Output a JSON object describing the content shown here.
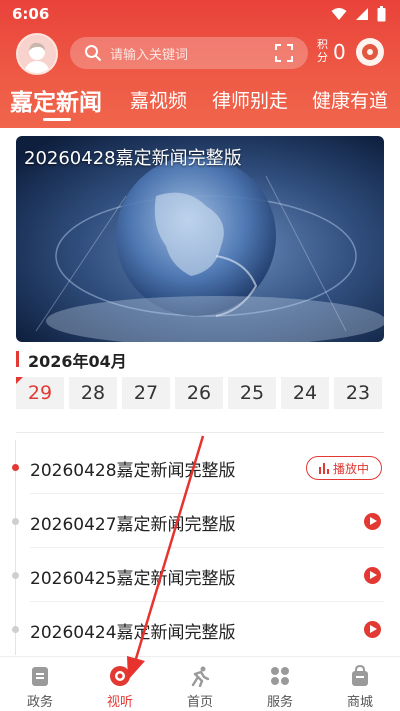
{
  "status_bar": {
    "time": "6:06"
  },
  "header": {
    "search": {
      "placeholder": "请输入关键词"
    },
    "points": {
      "label": "积分",
      "value": "0"
    }
  },
  "tabs": [
    {
      "label": "嘉定新闻",
      "active": true
    },
    {
      "label": "嘉视频"
    },
    {
      "label": "律师别走"
    },
    {
      "label": "健康有道"
    }
  ],
  "video": {
    "title": "20260428嘉定新闻完整版"
  },
  "calendar": {
    "month": "2026年04月",
    "dates": [
      "29",
      "28",
      "27",
      "26",
      "25",
      "24",
      "23"
    ],
    "selected": "29"
  },
  "episodes": [
    {
      "title": "20260428嘉定新闻完整版",
      "status": "播放中"
    },
    {
      "title": "20260427嘉定新闻完整版"
    },
    {
      "title": "20260425嘉定新闻完整版"
    },
    {
      "title": "20260424嘉定新闻完整版"
    }
  ],
  "bottom_nav": [
    {
      "label": "政务",
      "icon": "clipboard-icon"
    },
    {
      "label": "视听",
      "icon": "record-icon",
      "active": true
    },
    {
      "label": "首页",
      "icon": "home-runner-icon"
    },
    {
      "label": "服务",
      "icon": "grid-icon"
    },
    {
      "label": "商城",
      "icon": "shopping-bag-icon"
    }
  ],
  "colors": {
    "accent": "#e23a33",
    "header": "#ec4d3f"
  }
}
